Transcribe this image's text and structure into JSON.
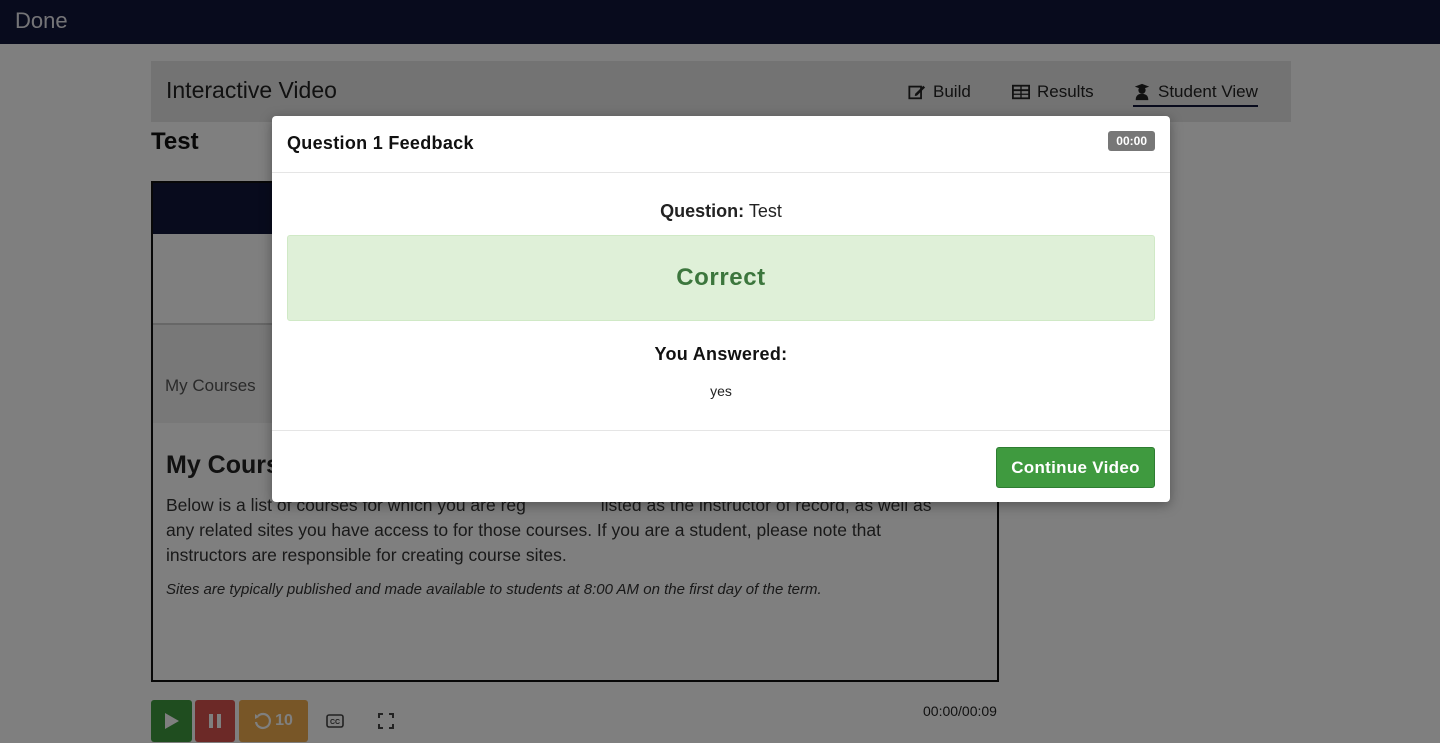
{
  "topbar": {
    "done_label": "Done"
  },
  "header": {
    "title": "Interactive Video",
    "nav": {
      "build": "Build",
      "results": "Results",
      "student_view": "Student View"
    }
  },
  "page": {
    "test_title": "Test"
  },
  "video": {
    "crumb": "My Courses",
    "heading": "My Cours",
    "body_line1": "Below is a list of courses for which you are reg",
    "body_line1b": "listed as the instructor of record, as well as",
    "body_line2": "any related sites you have access to for those courses. If you are a student, please note that",
    "body_line3": "instructors are responsible for creating course sites.",
    "note": "Sites are typically published and made available to students at 8:00 AM on the first day of the term."
  },
  "controls": {
    "rewind_label": "10",
    "time": "00:00/00:09"
  },
  "modal": {
    "title": "Question 1 Feedback",
    "timer": "00:00",
    "question_label": "Question:",
    "question_value": "Test",
    "result": "Correct",
    "answered_label": "You Answered:",
    "answered_value": "yes",
    "continue_label": "Continue Video"
  },
  "colors": {
    "navy": "#10163a",
    "success_green": "#3f9a3f",
    "correct_bg": "#dff0d8",
    "correct_text": "#3c763d",
    "pause_red": "#d9534f",
    "rewind_orange": "#f0ad4e"
  }
}
